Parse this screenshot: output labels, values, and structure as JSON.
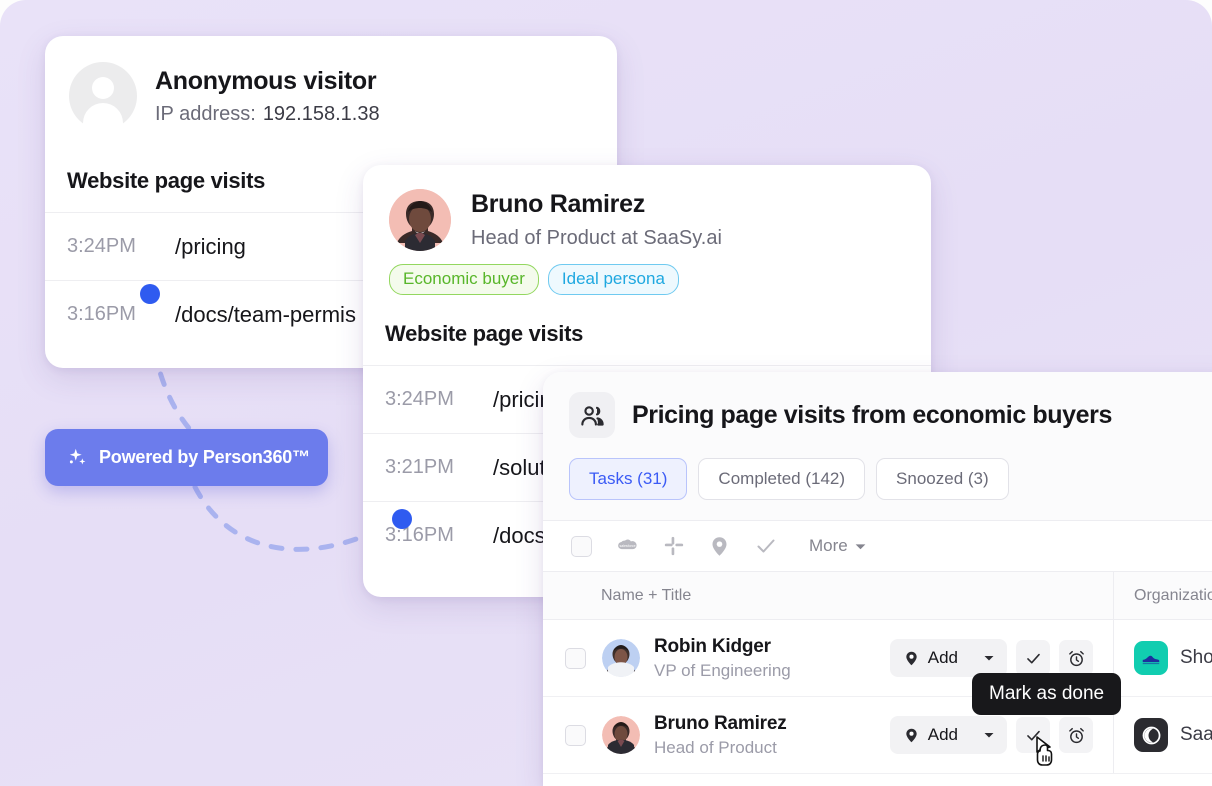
{
  "theme": {
    "background": "#e8e1f7",
    "accent_blue": "#3b5bf5",
    "badge_purple": "#6c7cec",
    "tag_green": "#58b62a",
    "tag_blue": "#1fa8e0",
    "tooltip_bg": "#18181b"
  },
  "anon_card": {
    "avatar_icon": "person-placeholder-icon",
    "name": "Anonymous visitor",
    "ip_label": "IP address:",
    "ip_value": "192.158.1.38",
    "section_title": "Website page visits",
    "visits": [
      {
        "time": "3:24PM",
        "path": "/pricing"
      },
      {
        "time": "3:16PM",
        "path": "/docs/team-permis"
      }
    ]
  },
  "powered_badge": {
    "icon": "sparkle-icon",
    "label": "Powered by Person360™"
  },
  "bruno_card": {
    "avatar_icon": "user-photo-bruno",
    "name": "Bruno Ramirez",
    "role": "Head of Product at SaaSy.ai",
    "tags": [
      {
        "label": "Economic buyer",
        "color": "green"
      },
      {
        "label": "Ideal persona",
        "color": "blue"
      }
    ],
    "section_title": "Website page visits",
    "visits": [
      {
        "time": "3:24PM",
        "path": "/pricin"
      },
      {
        "time": "3:21PM",
        "path": "/soluti"
      },
      {
        "time": "3:16PM",
        "path": "/docs/"
      }
    ]
  },
  "tasks_panel": {
    "header_icon": "people-icon",
    "title": "Pricing page visits from economic buyers",
    "tabs": [
      {
        "label": "Tasks (31)",
        "active": true
      },
      {
        "label": "Completed (142)",
        "active": false
      },
      {
        "label": "Snoozed (3)",
        "active": false
      }
    ],
    "toolbar": {
      "select_all": "select-all-checkbox",
      "icons": [
        "salesforce-icon",
        "slack-icon",
        "location-pin-icon",
        "check-icon"
      ],
      "more_label": "More"
    },
    "columns": [
      {
        "label": "Name + Title"
      },
      {
        "label": "Organization"
      }
    ],
    "rows": [
      {
        "name": "Robin Kidger",
        "title": "VP of Engineering",
        "avatar": "user-photo-robin",
        "add_label": "Add",
        "org_name": "Shoeva",
        "org_logo": "shoe-logo",
        "org_logo_color": "#11cdb0"
      },
      {
        "name": "Bruno Ramirez",
        "title": "Head of Product",
        "avatar": "user-photo-bruno",
        "add_label": "Add",
        "org_name": "SaaSy.",
        "org_logo": "saasy-logo",
        "org_logo_color": "#2b2b30"
      }
    ]
  },
  "tooltip": {
    "text": "Mark as done"
  }
}
